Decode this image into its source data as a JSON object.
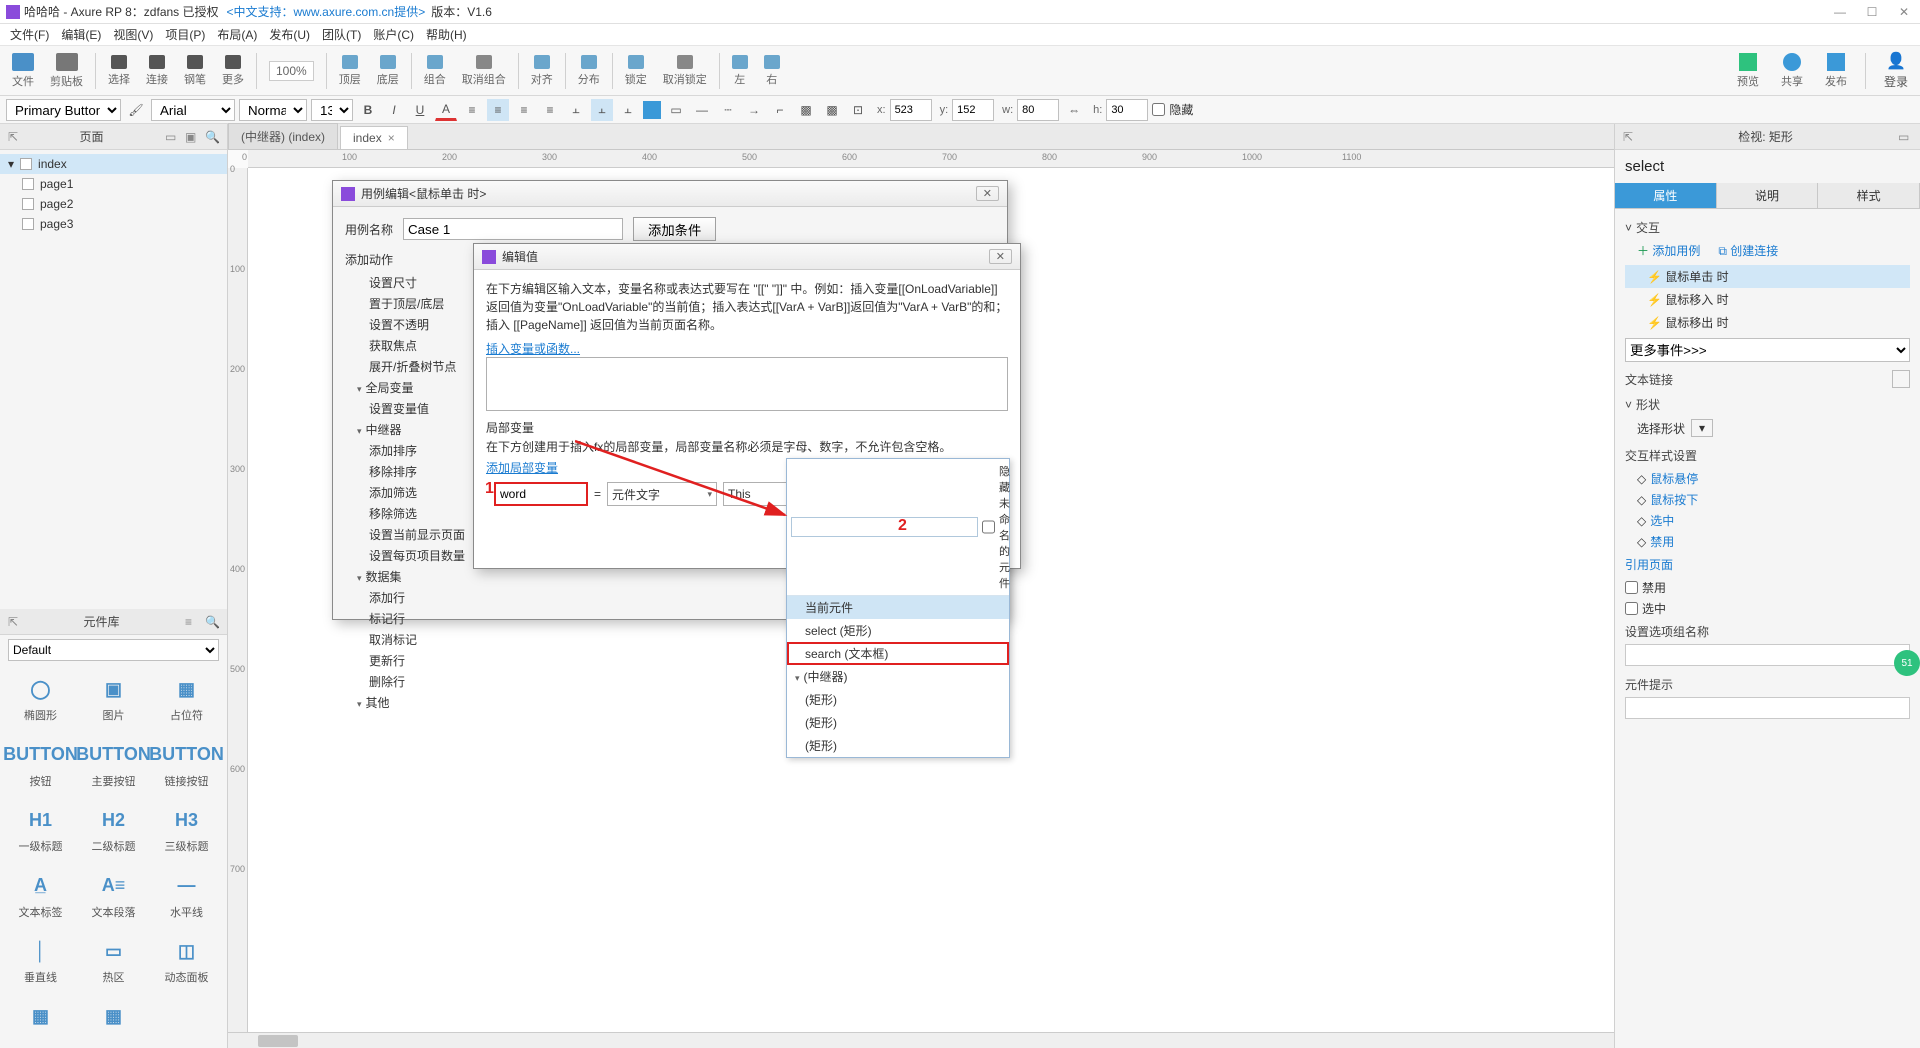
{
  "titlebar": {
    "app": "哈哈哈 - Axure RP 8：zdfans 已授权",
    "support": "<中文支持：www.axure.com.cn提供>",
    "version": "版本：V1.6"
  },
  "menu": [
    "文件(F)",
    "编辑(E)",
    "视图(V)",
    "项目(P)",
    "布局(A)",
    "发布(U)",
    "团队(T)",
    "账户(C)",
    "帮助(H)"
  ],
  "toolbar1": {
    "items": [
      "文件",
      "剪贴板",
      "",
      "选择",
      "",
      "连接",
      "",
      "钢笔",
      "更多",
      "",
      "顶层",
      "底层",
      "",
      "组合",
      "取消组合",
      "",
      "对齐",
      "",
      "分布",
      "",
      "锁定",
      "取消锁定",
      "",
      "左",
      "右"
    ],
    "zoom": "100%",
    "right": {
      "preview": "预览",
      "share": "共享",
      "publish": "发布",
      "login": "登录"
    }
  },
  "toolbar2": {
    "widget_type": "Primary Button",
    "font": "Arial",
    "weight": "Normal",
    "size": "13",
    "x_lbl": "x:",
    "x": "523",
    "y_lbl": "y:",
    "y": "152",
    "w_lbl": "w:",
    "w": "80",
    "h_lbl": "h:",
    "h": "30",
    "hidden": "隐藏"
  },
  "left": {
    "pages_hd": "页面",
    "pages": {
      "root": "index",
      "children": [
        "page1",
        "page2",
        "page3"
      ]
    },
    "lib_hd": "元件库",
    "lib_sel": "Default",
    "lib": [
      {
        "g": "◯",
        "l": "椭圆形"
      },
      {
        "g": "▣",
        "l": "图片"
      },
      {
        "g": "▦",
        "l": "占位符"
      },
      {
        "g": "BUTTON",
        "l": "按钮"
      },
      {
        "g": "BUTTON",
        "l": "主要按钮"
      },
      {
        "g": "BUTTON",
        "l": "链接按钮"
      },
      {
        "g": "H1",
        "l": "一级标题"
      },
      {
        "g": "H2",
        "l": "二级标题"
      },
      {
        "g": "H3",
        "l": "三级标题"
      },
      {
        "g": "A̲",
        "l": "文本标签"
      },
      {
        "g": "A≡",
        "l": "文本段落"
      },
      {
        "g": "—",
        "l": "水平线"
      },
      {
        "g": "│",
        "l": "垂直线"
      },
      {
        "g": "▭",
        "l": "热区"
      },
      {
        "g": "◫",
        "l": "动态面板"
      },
      {
        "g": "▦",
        "l": ""
      },
      {
        "g": "▦",
        "l": ""
      },
      {
        "g": "",
        "l": ""
      }
    ]
  },
  "tabs": [
    {
      "label": "(中继器) (index)",
      "active": false
    },
    {
      "label": "index",
      "active": true
    }
  ],
  "ruler_h": [
    "0",
    "100",
    "200",
    "300",
    "400",
    "500",
    "600",
    "700",
    "800",
    "900",
    "1000",
    "1100"
  ],
  "ruler_v": [
    "0",
    "100",
    "200",
    "300",
    "400",
    "500",
    "600",
    "700"
  ],
  "right": {
    "inspector_hd": "检视: 矩形",
    "name": "select",
    "tabs": [
      "属性",
      "说明",
      "样式"
    ],
    "section_interaction": "交互",
    "add_case": "添加用例",
    "create_link": "创建连接",
    "events": [
      "鼠标单击 时",
      "鼠标移入 时",
      "鼠标移出 时"
    ],
    "more_events": "更多事件>>>",
    "text_link": "文本链接",
    "shape": "形状",
    "select_shape": "选择形状",
    "ix_styles": "交互样式设置",
    "ix_opts": [
      "鼠标悬停",
      "鼠标按下",
      "选中",
      "禁用"
    ],
    "ref_page": "引用页面",
    "chk_disabled": "禁用",
    "chk_selected": "选中",
    "sel_group": "设置选项组名称",
    "tooltip": "元件提示"
  },
  "dlg1": {
    "title": "用例编辑<鼠标单击 时>",
    "name_lbl": "用例名称",
    "name_val": "Case 1",
    "add_cond": "添加条件",
    "add_action": "添加动作",
    "actions": [
      {
        "t": "设置尺寸"
      },
      {
        "t": "置于顶层/底层"
      },
      {
        "t": "设置不透明"
      },
      {
        "t": "获取焦点"
      },
      {
        "t": "展开/折叠树节点"
      },
      {
        "t": "全局变量",
        "g": true
      },
      {
        "t": "设置变量值"
      },
      {
        "t": "中继器",
        "g": true
      },
      {
        "t": "添加排序"
      },
      {
        "t": "移除排序"
      },
      {
        "t": "添加筛选"
      },
      {
        "t": "移除筛选"
      },
      {
        "t": "设置当前显示页面"
      },
      {
        "t": "设置每页项目数量"
      },
      {
        "t": "数据集",
        "g": true
      },
      {
        "t": "添加行"
      },
      {
        "t": "标记行"
      },
      {
        "t": "取消标记"
      },
      {
        "t": "更新行"
      },
      {
        "t": "删除行"
      },
      {
        "t": "其他",
        "g": true
      }
    ]
  },
  "dlg2": {
    "title": "编辑值",
    "desc": "在下方编辑区输入文本，变量名称或表达式要写在 \"[[\" \"]]\" 中。例如：插入变量[[OnLoadVariable]]返回值为变量\"OnLoadVariable\"的当前值；插入表达式[[VarA + VarB]]返回值为\"VarA + VarB\"的和；插入 [[PageName]] 返回值为当前页面名称。",
    "insert_var": "插入变量或函数...",
    "local_hd": "局部变量",
    "local_desc": "在下方创建用于插入fx的局部变量，局部变量名称必须是字母、数字，不允许包含空格。",
    "add_local": "添加局部变量",
    "var_name": "word",
    "eq": "=",
    "src_type": "元件文字",
    "target": "This",
    "hide_unnamed": "隐藏未命名的元件"
  },
  "dropdown": {
    "items": [
      {
        "t": "当前元件",
        "hl": true
      },
      {
        "t": "select (矩形)"
      },
      {
        "t": "search (文本框)",
        "red": true
      },
      {
        "t": "(中继器)",
        "g": true
      },
      {
        "t": "(矩形)"
      },
      {
        "t": "(矩形)"
      },
      {
        "t": "(矩形)"
      }
    ]
  },
  "anno": {
    "n1": "1",
    "n2": "2"
  }
}
